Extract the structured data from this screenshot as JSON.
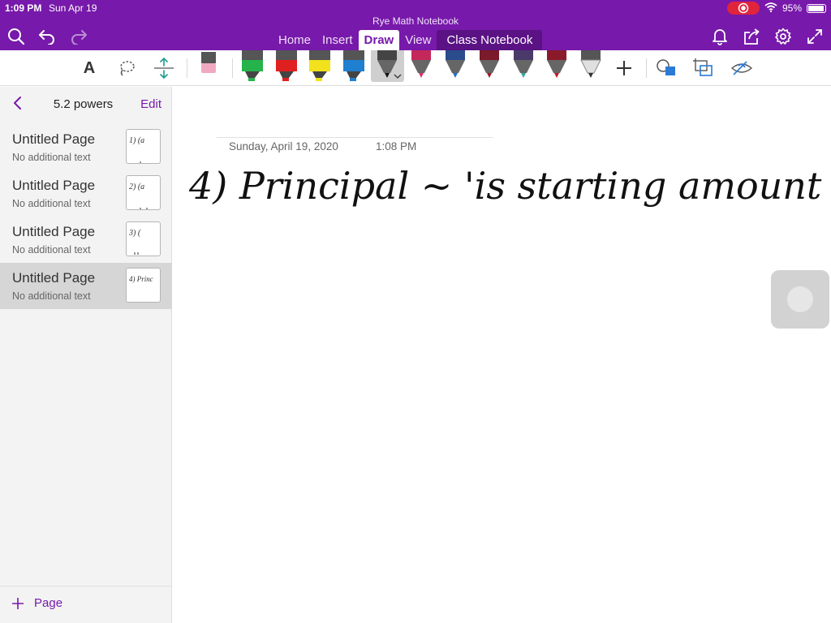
{
  "status_bar": {
    "time": "1:09 PM",
    "date": "Sun Apr 19",
    "battery": "95%",
    "battery_level": 0.95
  },
  "app": {
    "title": "Rye Math Notebook",
    "tabs": [
      {
        "label": "Home",
        "active": false
      },
      {
        "label": "Insert",
        "active": false
      },
      {
        "label": "Draw",
        "active": true
      },
      {
        "label": "View",
        "active": false
      },
      {
        "label": "Class Notebook",
        "active": false
      }
    ]
  },
  "header_icons": [
    "search-icon",
    "undo-icon",
    "redo-icon",
    "bell-icon",
    "share-icon",
    "gear-icon",
    "expand-icon"
  ],
  "ribbon": {
    "type_tool_label": "A",
    "tools": [
      "type-text-icon",
      "lasso-select-icon",
      "insert-space-icon",
      "eraser-icon",
      "green-highlighter-icon",
      "red-highlighter-icon",
      "yellow-highlighter-icon",
      "blue-highlighter-icon",
      "black-pen-icon",
      "pink-pen-icon",
      "blue-pen-icon",
      "dark-red-pen-icon",
      "teal-pen-icon",
      "red-pen-icon",
      "pencil-icon",
      "add-pen-icon",
      "ink-to-shape-icon",
      "convert-ink-icon",
      "ink-replay-icon"
    ],
    "selected_tool": "black-pen-icon"
  },
  "colors": {
    "accent": "#7719aa",
    "header": "#7719aa",
    "selected_row": "#d6d6d6",
    "recording": "#e0243c"
  },
  "sidebar": {
    "section_title": "5.2 powers",
    "edit_label": "Edit",
    "add_page_label": "Page",
    "pages": [
      {
        "title": "Untitled Page",
        "subtitle": "No additional text",
        "thumb_text": "1) (a",
        "selected": false
      },
      {
        "title": "Untitled Page",
        "subtitle": "No additional text",
        "thumb_text": "2) (a",
        "selected": false
      },
      {
        "title": "Untitled Page",
        "subtitle": "No additional text",
        "thumb_text": "3) (",
        "selected": false
      },
      {
        "title": "Untitled Page",
        "subtitle": "No additional text",
        "thumb_text": "4) Princ",
        "selected": true
      }
    ]
  },
  "page": {
    "date": "Sunday, April 19, 2020",
    "time": "1:08 PM",
    "handwriting": "4) Principal ~ 'is starting amount"
  }
}
